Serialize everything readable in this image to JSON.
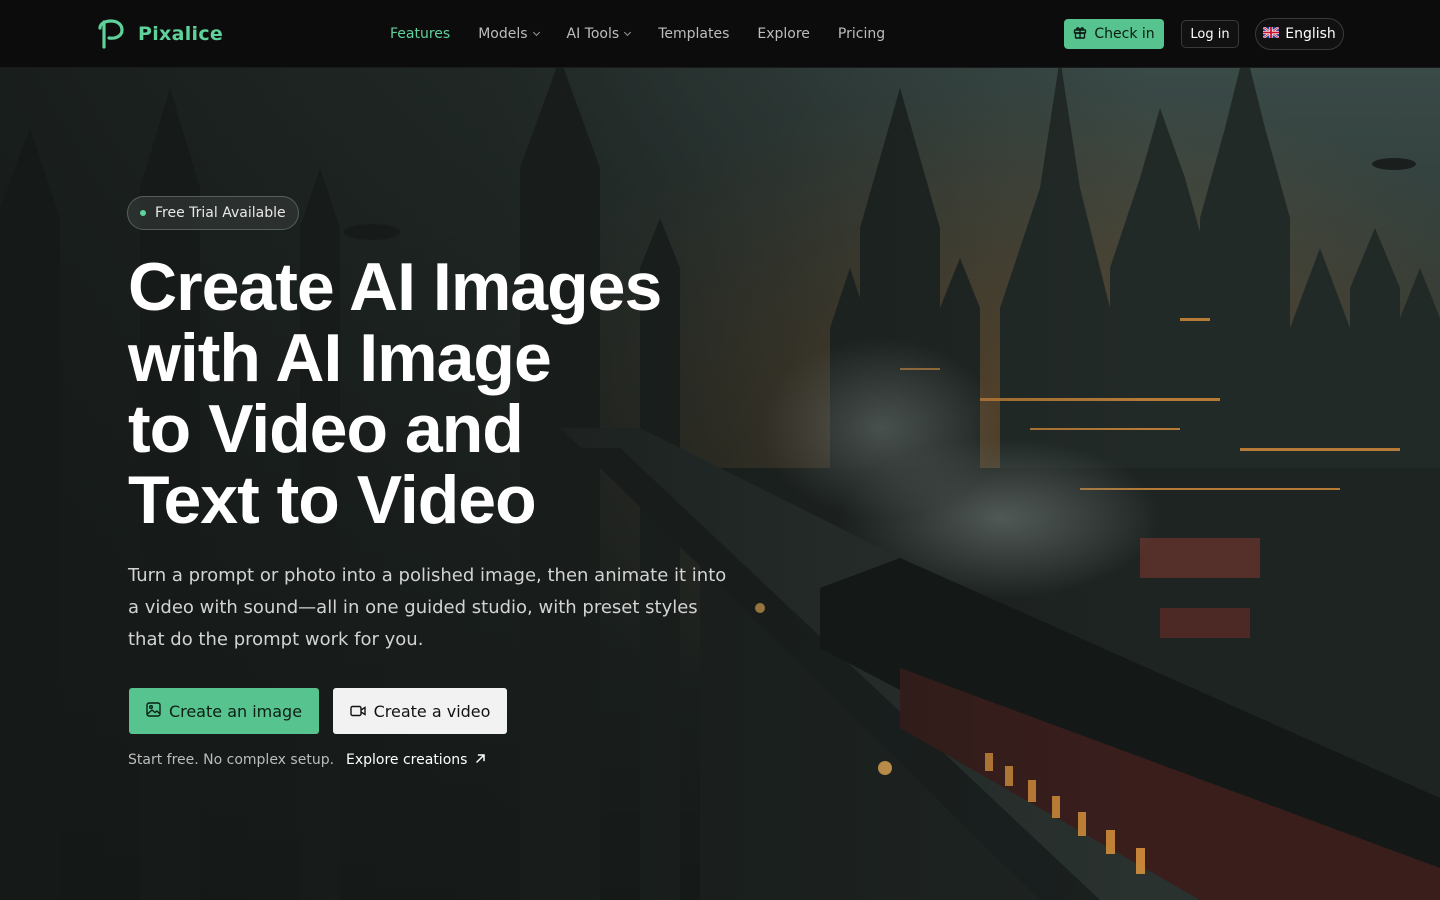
{
  "brand": {
    "name": "Pixalice"
  },
  "nav": {
    "items": [
      {
        "label": "Features",
        "active": true,
        "has_dropdown": false
      },
      {
        "label": "Models",
        "active": false,
        "has_dropdown": true
      },
      {
        "label": "AI Tools",
        "active": false,
        "has_dropdown": true
      },
      {
        "label": "Templates",
        "active": false,
        "has_dropdown": false
      },
      {
        "label": "Explore",
        "active": false,
        "has_dropdown": false
      },
      {
        "label": "Pricing",
        "active": false,
        "has_dropdown": false
      }
    ]
  },
  "header_actions": {
    "checkin_label": "Check in",
    "checkin_icon": "gift-icon",
    "login_label": "Log in",
    "language_label": "English",
    "language_icon": "uk-flag-icon"
  },
  "hero": {
    "badge": "Free Trial Available",
    "title_lines": [
      "Create AI Images",
      "with AI Image",
      "to Video and",
      "Text to Video"
    ],
    "subtitle": "Turn a prompt or photo into a polished image, then animate it into a video with sound—all in one guided studio, with preset styles that do the prompt work for you.",
    "primary_cta": {
      "label": "Create an image",
      "icon": "image-icon"
    },
    "secondary_cta": {
      "label": "Create a video",
      "icon": "video-camera-icon"
    },
    "note": "Start free. No complex setup.",
    "explore_link": {
      "label": "Explore creations",
      "icon": "arrow-up-right-icon"
    }
  },
  "colors": {
    "accent": "#57c48f",
    "brand_text": "#5fd19b",
    "header_bg": "#0c0c0c"
  }
}
